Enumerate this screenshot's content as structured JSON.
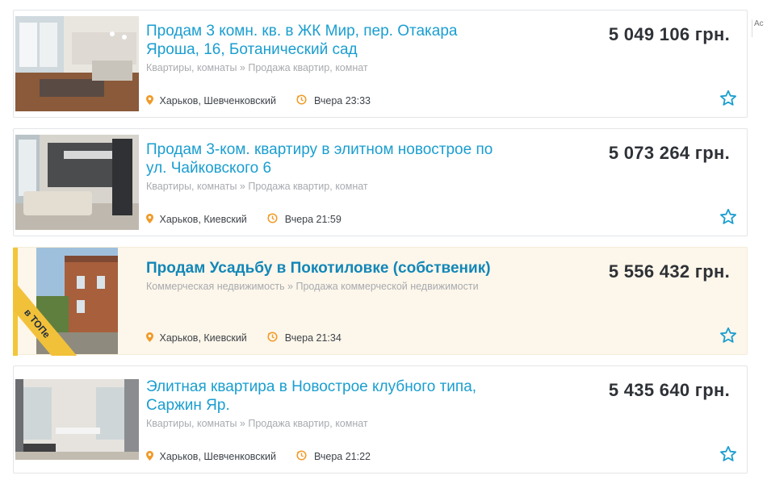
{
  "listings": [
    {
      "title": "Продам 3 комн. кв. в ЖК Мир, пер. Отакара Яроша, 16, Ботанический сад",
      "category": "Квартиры, комнаты » Продажа квартир, комнат",
      "price": "5 049 106 грн.",
      "location": "Харьков, Шевченковский",
      "time": "Вчера 23:33",
      "promoted": false
    },
    {
      "title": "Продам 3-ком. квартиру в элитном новострое по ул. Чайковского 6",
      "category": "Квартиры, комнаты » Продажа квартир, комнат",
      "price": "5 073 264 грн.",
      "location": "Харьков, Киевский",
      "time": "Вчера 21:59",
      "promoted": false
    },
    {
      "title": "Продам Усадьбу в Покотиловке (собственик)",
      "category": "Коммерческая недвижимость » Продажа коммерческой недвижимости",
      "price": "5 556 432 грн.",
      "location": "Харьков, Киевский",
      "time": "Вчера 21:34",
      "promoted": true,
      "badge": "в ТОПе"
    },
    {
      "title": "Элитная квартира в Новострое клубного типа, Саржин Яр.",
      "category": "Квартиры, комнаты » Продажа квартир, комнат",
      "price": "5 435 640 грн.",
      "location": "Харьков, Шевченковский",
      "time": "Вчера 21:22",
      "promoted": false
    }
  ],
  "edge_fragment": "Ac",
  "colors": {
    "title": "#1a9ed0",
    "accent": "#1a9ed0",
    "pin": "#f19a27",
    "promo_bg": "#fdf6ea",
    "badge": "#f2c13a"
  },
  "icons": {
    "location": "map-pin-icon",
    "time": "history-clock-icon",
    "favorite": "star-outline-icon"
  }
}
